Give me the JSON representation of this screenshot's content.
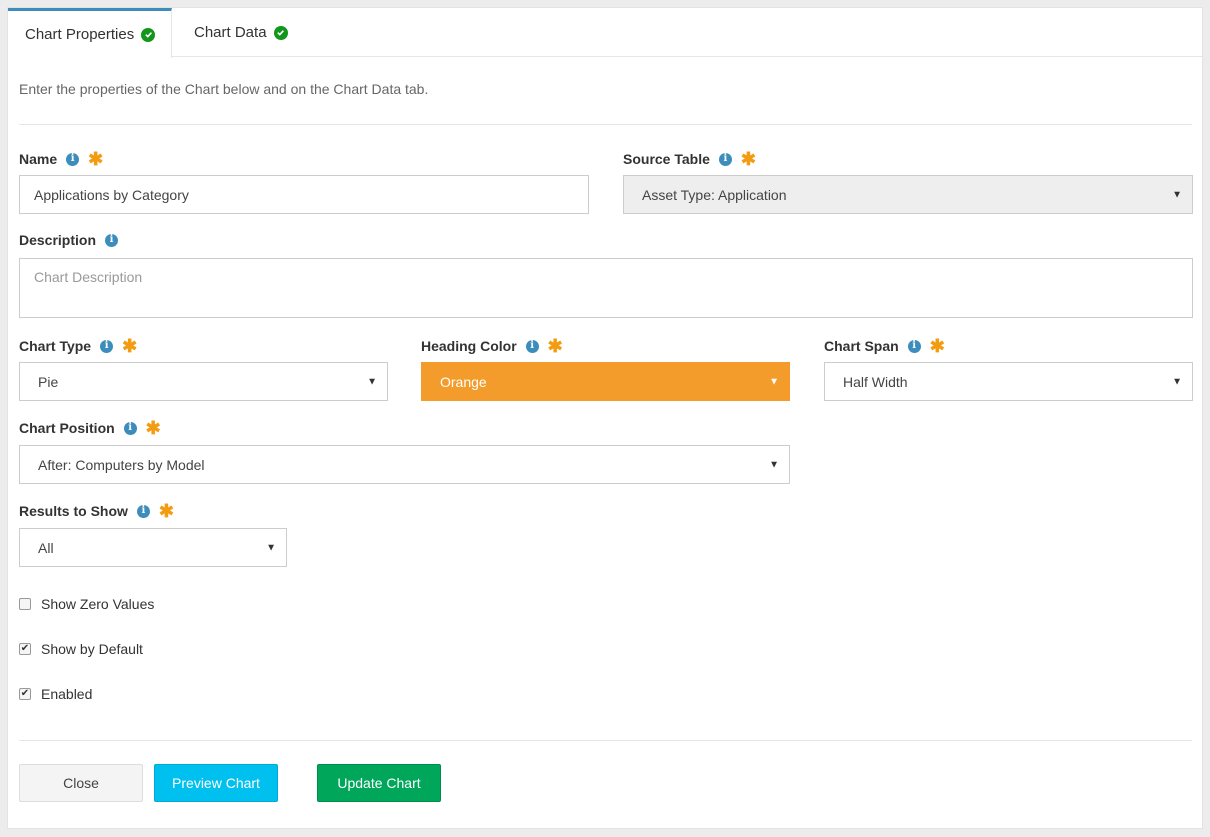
{
  "tabs": [
    {
      "label": "Chart Properties",
      "active": true
    },
    {
      "label": "Chart Data",
      "active": false
    }
  ],
  "intro_text": "Enter the properties of the Chart below and on the Chart Data tab.",
  "fields": {
    "name": {
      "label": "Name",
      "value": "Applications by Category"
    },
    "source_table": {
      "label": "Source Table",
      "value": "Asset Type: Application"
    },
    "description": {
      "label": "Description",
      "placeholder": "Chart Description"
    },
    "chart_type": {
      "label": "Chart Type",
      "value": "Pie"
    },
    "heading_color": {
      "label": "Heading Color",
      "value": "Orange",
      "color": "#f39c2b"
    },
    "chart_span": {
      "label": "Chart Span",
      "value": "Half Width"
    },
    "chart_position": {
      "label": "Chart Position",
      "value": "After: Computers by Model"
    },
    "results_to_show": {
      "label": "Results to Show",
      "value": "All"
    }
  },
  "checkboxes": [
    {
      "label": "Show Zero Values",
      "checked": false
    },
    {
      "label": "Show by Default",
      "checked": true
    },
    {
      "label": "Enabled",
      "checked": true
    }
  ],
  "buttons": {
    "close": "Close",
    "preview": "Preview Chart",
    "update": "Update Chart"
  },
  "icons": {
    "info": "info-icon",
    "required": "asterisk-icon",
    "check": "check-circle-icon"
  }
}
